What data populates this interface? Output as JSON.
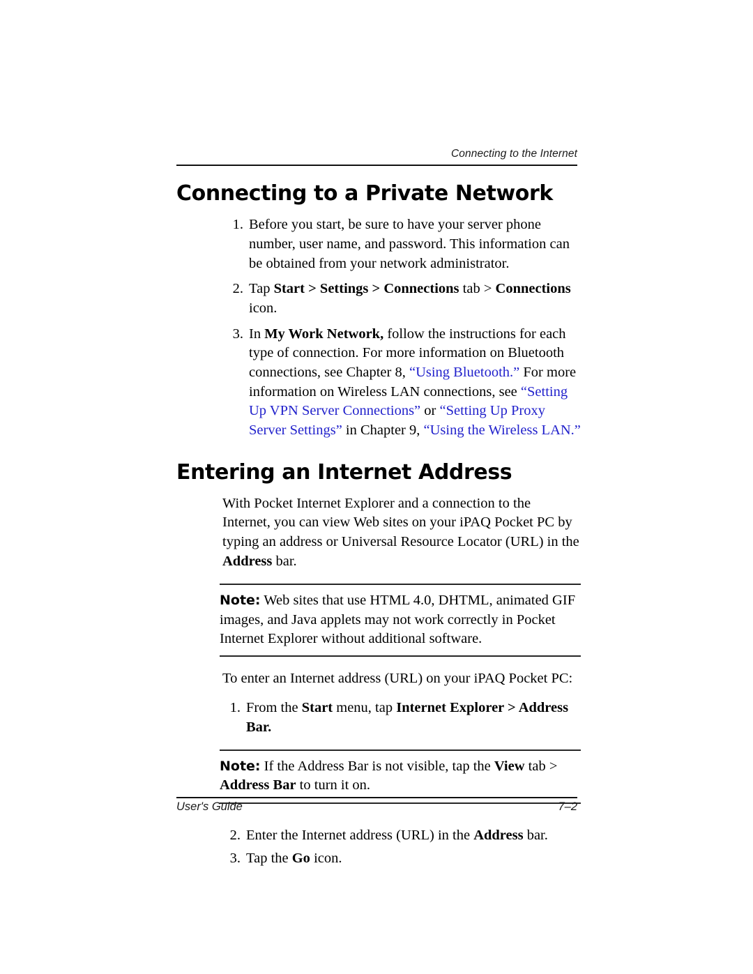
{
  "page": {
    "running_head": "Connecting to the Internet",
    "footer_left": "User's Guide",
    "footer_right": "7–2",
    "link_color": "#2222cc",
    "text_color": "#000000"
  },
  "sections": [
    {
      "title": "Connecting to a Private Network",
      "steps": [
        {
          "num": "1.",
          "parts": [
            {
              "text": "Before you start, be sure to have your server phone number, user name, and password. This information can be obtained from your network administrator.",
              "style": "normal"
            }
          ]
        },
        {
          "num": "2.",
          "parts": [
            {
              "text": "Tap ",
              "style": "normal"
            },
            {
              "text": "Start > Settings > Connections",
              "style": "bold"
            },
            {
              "text": " tab > ",
              "style": "normal"
            },
            {
              "text": "Connections",
              "style": "bold"
            },
            {
              "text": " icon.",
              "style": "normal"
            }
          ]
        },
        {
          "num": "3.",
          "parts": [
            {
              "text": "In ",
              "style": "normal"
            },
            {
              "text": "My Work Network,",
              "style": "bold"
            },
            {
              "text": " follow the instructions for each type of connection. For more information on Bluetooth connections, see Chapter 8, ",
              "style": "normal"
            },
            {
              "text": "“Using Bluetooth.”",
              "style": "link"
            },
            {
              "text": " For more information on Wireless LAN connections, see ",
              "style": "normal"
            },
            {
              "text": "“Setting Up VPN Server Connections”",
              "style": "link"
            },
            {
              "text": " or ",
              "style": "normal"
            },
            {
              "text": "“Setting Up Proxy Server Settings”",
              "style": "link"
            },
            {
              "text": " in Chapter 9, ",
              "style": "normal"
            },
            {
              "text": "“Using the Wireless LAN.”",
              "style": "link"
            }
          ]
        }
      ]
    },
    {
      "title": "Entering an Internet Address",
      "intro_parts": [
        {
          "text": "With Pocket Internet Explorer and a connection to the Internet, you can view Web sites on your iPAQ Pocket PC by typing an address or Universal Resource Locator (URL) in the ",
          "style": "normal"
        },
        {
          "text": "Address",
          "style": "bold"
        },
        {
          "text": " bar.",
          "style": "normal"
        }
      ],
      "note_1": {
        "label": "Note:",
        "parts": [
          {
            "text": " Web sites that use HTML 4.0, DHTML, animated GIF images, and Java applets may not work correctly in Pocket Internet Explorer without additional software.",
            "style": "normal"
          }
        ]
      },
      "lead_in": "To enter an Internet address (URL) on your iPAQ Pocket PC:",
      "step_1": {
        "num": "1.",
        "parts": [
          {
            "text": "From the ",
            "style": "normal"
          },
          {
            "text": "Start",
            "style": "bold"
          },
          {
            "text": " menu, tap ",
            "style": "normal"
          },
          {
            "text": "Internet Explorer > Address Bar.",
            "style": "bold"
          }
        ]
      },
      "note_2": {
        "label": "Note:",
        "parts": [
          {
            "text": " If the Address Bar is not visible, tap the ",
            "style": "normal"
          },
          {
            "text": "View",
            "style": "bold"
          },
          {
            "text": " tab > ",
            "style": "normal"
          },
          {
            "text": "Address Bar",
            "style": "bold"
          },
          {
            "text": " to turn it on.",
            "style": "normal"
          }
        ]
      },
      "steps_tail": [
        {
          "num": "2.",
          "parts": [
            {
              "text": "Enter the Internet address (URL) in the ",
              "style": "normal"
            },
            {
              "text": "Address",
              "style": "bold"
            },
            {
              "text": " bar.",
              "style": "normal"
            }
          ]
        },
        {
          "num": "3.",
          "parts": [
            {
              "text": "Tap the ",
              "style": "normal"
            },
            {
              "text": "Go",
              "style": "bold"
            },
            {
              "text": " icon.",
              "style": "normal"
            }
          ]
        }
      ]
    }
  ]
}
